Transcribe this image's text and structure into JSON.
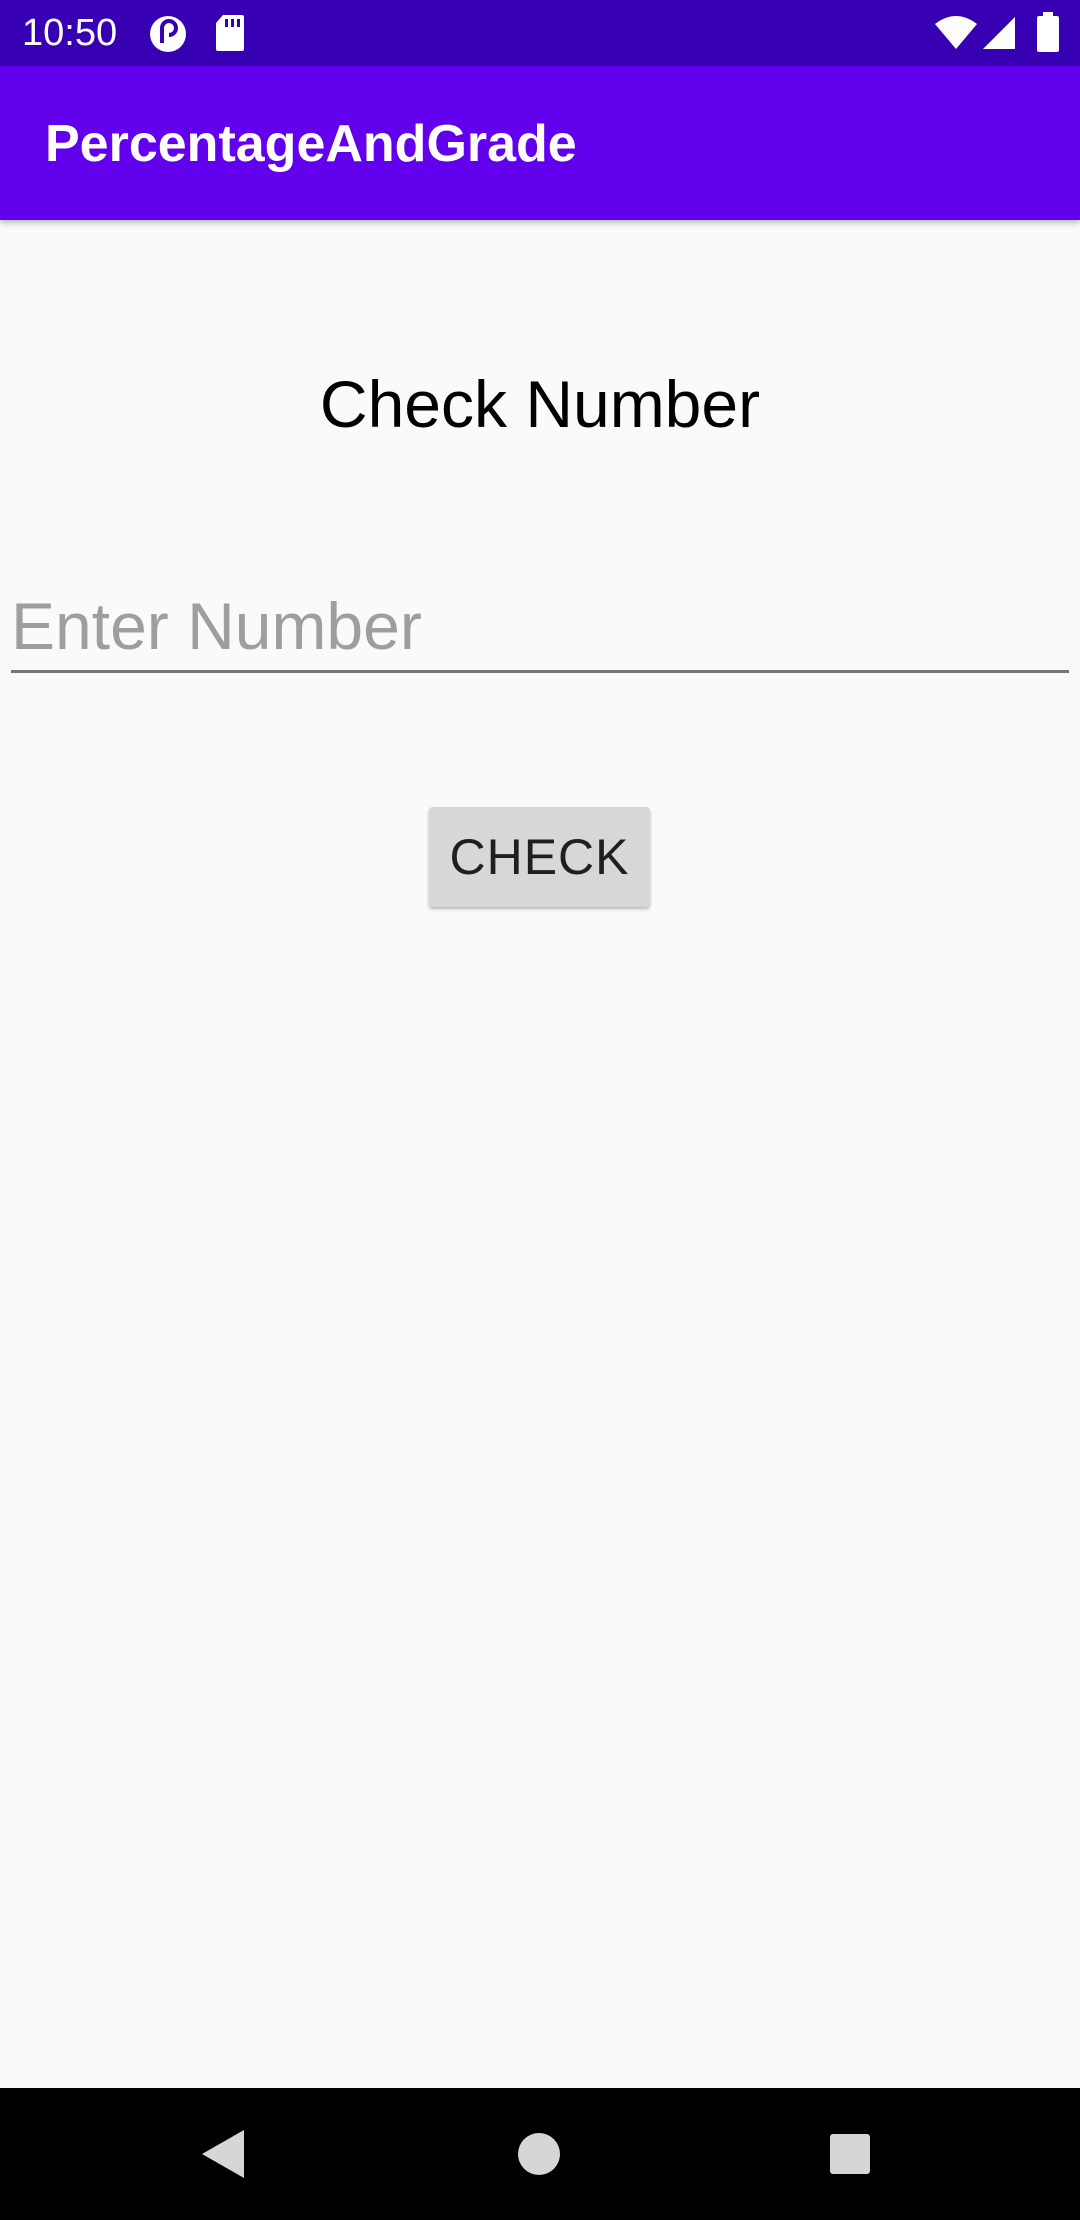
{
  "status_bar": {
    "time": "10:50",
    "icons": [
      "pocket-casts-icon",
      "sd-card-icon",
      "wifi-icon",
      "signal-icon",
      "battery-icon"
    ]
  },
  "app_bar": {
    "title": "PercentageAndGrade"
  },
  "main": {
    "heading": "Check Number",
    "input": {
      "value": "",
      "placeholder": "Enter Number"
    },
    "check_button_label": "CHECK"
  },
  "nav_bar": {
    "buttons": [
      "back-icon",
      "home-icon",
      "recents-icon"
    ]
  },
  "colors": {
    "status_bar": "#3700B3",
    "app_bar": "#6200EE",
    "background": "#FAFAFA",
    "button": "#D6D7D7"
  }
}
